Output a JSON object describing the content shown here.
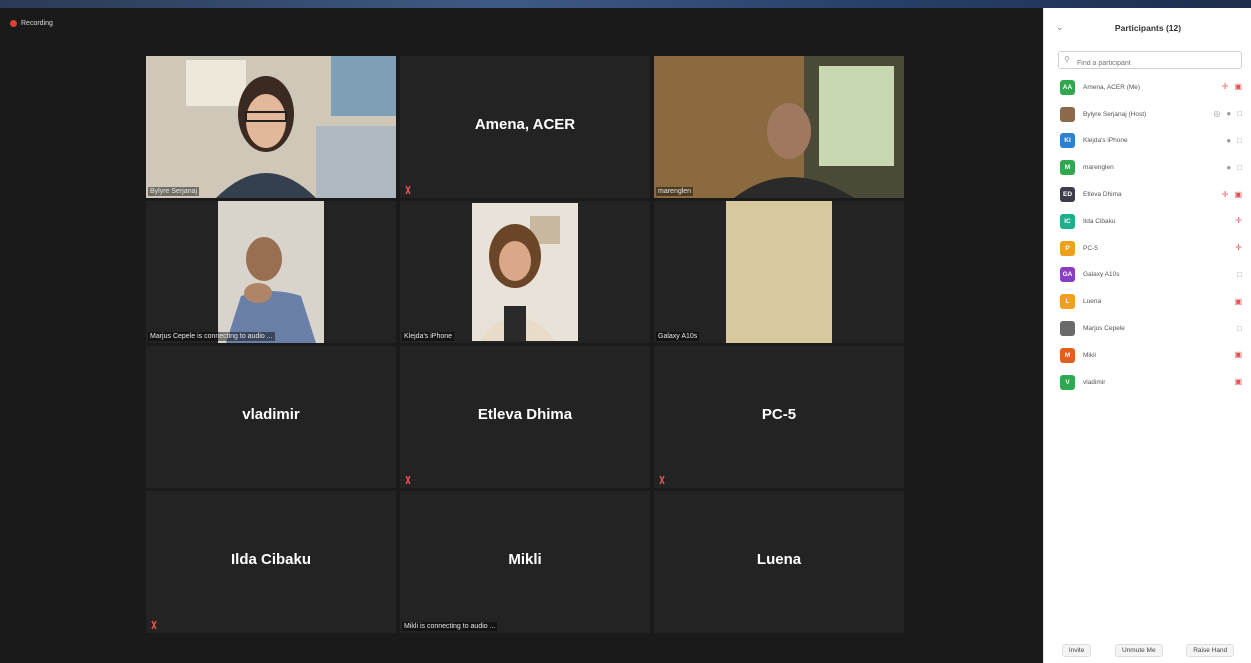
{
  "recording": {
    "label": "Recording"
  },
  "tiles": {
    "t1": {
      "caption": "Bylyre Serjanaj"
    },
    "t2": {
      "name": "Amena, ACER"
    },
    "t3": {
      "caption": "marenglen"
    },
    "t4": {
      "caption": "Marjus Cepele is connecting to audio ..."
    },
    "t5": {
      "caption": "Klejda's iPhone"
    },
    "t6": {
      "caption": "Galaxy A10s"
    },
    "t7": {
      "name": "vladimir"
    },
    "t8": {
      "name": "Etleva Dhima"
    },
    "t9": {
      "name": "PC-5"
    },
    "t10": {
      "name": "Ilda Cibaku"
    },
    "t11": {
      "name": "Mikli",
      "caption": "Mikli is connecting to audio ..."
    },
    "t12": {
      "name": "Luena"
    }
  },
  "sidebar": {
    "title": "Participants (12)",
    "search_placeholder": "Find a participant",
    "participants": [
      {
        "initials": "AA",
        "name": "Amena, ACER (Me)",
        "color": "#2fa84f"
      },
      {
        "initials": "",
        "name": "Bylyre Serjanaj (Host)",
        "color": "#8a6a4a"
      },
      {
        "initials": "KI",
        "name": "Klejda's iPhone",
        "color": "#2d7fd0"
      },
      {
        "initials": "M",
        "name": "marenglen",
        "color": "#2fa84f"
      },
      {
        "initials": "ED",
        "name": "Etleva Dhima",
        "color": "#3c3c4a"
      },
      {
        "initials": "IC",
        "name": "Ilda Cibaku",
        "color": "#1fae8a"
      },
      {
        "initials": "P",
        "name": "PC-5",
        "color": "#f0a020"
      },
      {
        "initials": "GA",
        "name": "Galaxy A10s",
        "color": "#8a3fc0"
      },
      {
        "initials": "L",
        "name": "Luena",
        "color": "#f0a020"
      },
      {
        "initials": "",
        "name": "Marjus Cepele",
        "color": "#6a6a6a"
      },
      {
        "initials": "M",
        "name": "Mikli",
        "color": "#e0601f"
      },
      {
        "initials": "V",
        "name": "vladimir",
        "color": "#2fa84f"
      }
    ],
    "footer": {
      "invite": "Invite",
      "unmute": "Unmute Me",
      "raise": "Raise Hand"
    }
  },
  "colors": {
    "muted_red": "#e55050",
    "active_border": "#c9c95a",
    "tile_bg": "#232323"
  }
}
